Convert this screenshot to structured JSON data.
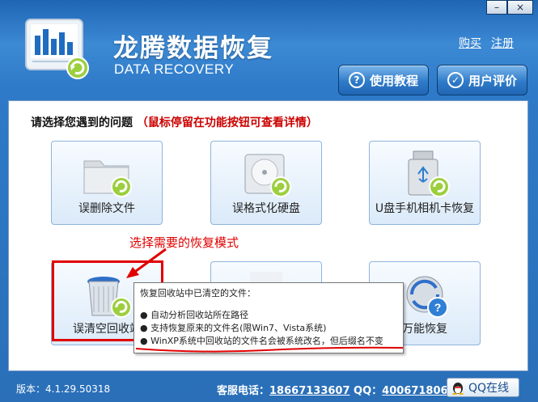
{
  "window": {
    "minimize": "–",
    "close": "×"
  },
  "header": {
    "title": "龙腾数据恢复",
    "subtitle": "DATA RECOVERY",
    "buy_link": "购买",
    "register_link": "注册",
    "tutorial_button": "使用教程",
    "review_button": "用户评价"
  },
  "main": {
    "prompt": "请选择您遇到的问题",
    "hint": "（鼠标停留在功能按钮可查看详情）",
    "tiles": [
      {
        "label": "误删除文件",
        "icon": "folder-icon"
      },
      {
        "label": "误格式化硬盘",
        "icon": "hard-disk-icon"
      },
      {
        "label": "U盘手机相机卡恢复",
        "icon": "usb-drive-icon"
      },
      {
        "label": "误清空回收站",
        "icon": "recycle-bin-icon"
      },
      {
        "label": "",
        "icon": "blank-tile-icon"
      },
      {
        "label": "万能恢复",
        "icon": "universal-recovery-icon"
      }
    ]
  },
  "annotation": {
    "callout": "选择需要的恢复模式"
  },
  "tooltip": {
    "title": "恢复回收站中已清空的文件：",
    "lines": [
      "● 自动分析回收站所在路径",
      "● 支持恢复原来的文件名(限Win7、Vista系统)",
      "● WinXP系统中回收站的文件名会被系统改名，但后缀名不变"
    ]
  },
  "statusbar": {
    "version": "版本：4.1.29.50318",
    "contact_prefix": "客服电话：",
    "phone": "18667133607",
    "qq_prefix": " QQ：",
    "qq": "4006718068",
    "qq_button": "QQ在线"
  },
  "colors": {
    "accent": "#2a6fb8",
    "hint_red": "#cc0000",
    "annotation_red": "#e00000"
  }
}
